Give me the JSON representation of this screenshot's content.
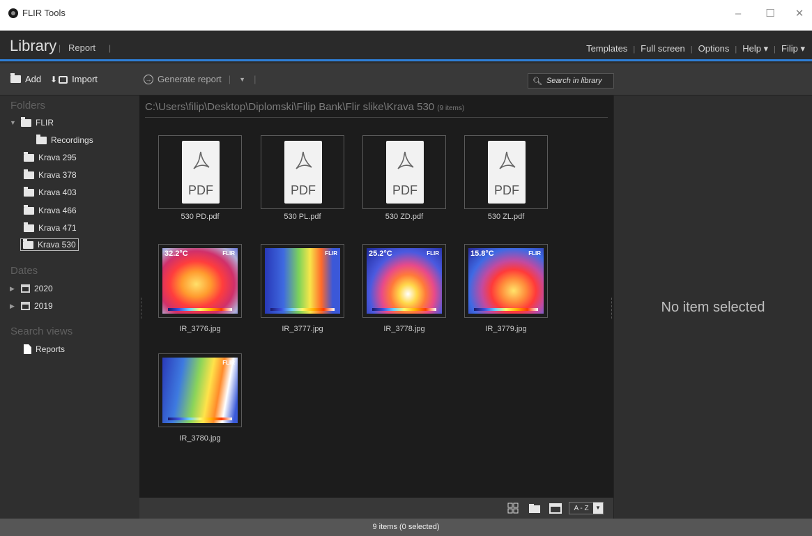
{
  "window": {
    "title": "FLIR Tools",
    "minimize": "–",
    "maximize": "☐",
    "close": "✕"
  },
  "menu": {
    "library": "Library",
    "report": "Report",
    "right_items": [
      "Templates",
      "Full screen",
      "Options",
      "Help ▾",
      "Filip ▾"
    ]
  },
  "toolbar": {
    "add": "Add",
    "import": "Import",
    "generate_report": "Generate report",
    "search_placeholder": "Search in library"
  },
  "sidebar": {
    "folders_header": "Folders",
    "folders": [
      {
        "label": "FLIR",
        "expanded": true
      },
      {
        "label": "Recordings"
      },
      {
        "label": "Krava 295"
      },
      {
        "label": "Krava 378"
      },
      {
        "label": "Krava 403"
      },
      {
        "label": "Krava 466"
      },
      {
        "label": "Krava 471"
      },
      {
        "label": "Krava 530",
        "selected": true
      }
    ],
    "dates_header": "Dates",
    "dates": [
      {
        "label": "2020"
      },
      {
        "label": "2019"
      }
    ],
    "search_views_header": "Search views",
    "search_views": [
      {
        "label": "Reports"
      }
    ]
  },
  "main": {
    "path": "C:\\Users\\filip\\Desktop\\Diplomski\\Filip Bank\\Flir slike\\Krava 530",
    "item_count": "(9 items)",
    "files": [
      {
        "name": "530 PD.pdf",
        "type": "pdf",
        "badge": "PDF"
      },
      {
        "name": "530 PL.pdf",
        "type": "pdf",
        "badge": "PDF"
      },
      {
        "name": "530 ZD.pdf",
        "type": "pdf",
        "badge": "PDF"
      },
      {
        "name": "530 ZL.pdf",
        "type": "pdf",
        "badge": "PDF"
      },
      {
        "name": "IR_3776.jpg",
        "type": "ir",
        "temp": "32.2°C",
        "brand": "FLIR"
      },
      {
        "name": "IR_3777.jpg",
        "type": "ir",
        "temp": "",
        "brand": "FLIR"
      },
      {
        "name": "IR_3778.jpg",
        "type": "ir",
        "temp": "25.2°C",
        "brand": "FLIR"
      },
      {
        "name": "IR_3779.jpg",
        "type": "ir",
        "temp": "15.8°C",
        "brand": "FLIR"
      },
      {
        "name": "IR_3780.jpg",
        "type": "ir",
        "temp": "",
        "brand": "FLIR"
      }
    ],
    "sort_label": "A - Z"
  },
  "right_panel": {
    "empty_text": "No item selected"
  },
  "status": {
    "text": "9 items  (0 selected)"
  }
}
